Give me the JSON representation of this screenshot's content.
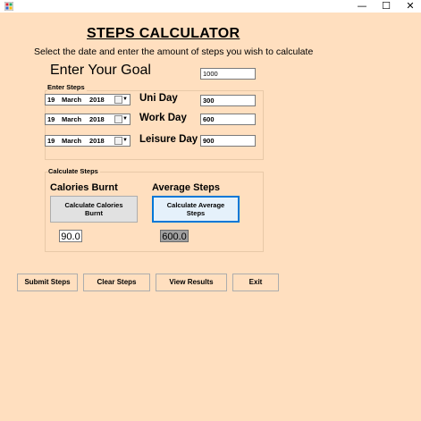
{
  "window": {
    "minimize_glyph": "—",
    "maximize_glyph": "☐",
    "close_glyph": "✕"
  },
  "header": {
    "title": "STEPS CALCULATOR",
    "subtitle": "Select the date and enter the amount of steps you wish to calculate"
  },
  "goal": {
    "label": "Enter Your Goal",
    "value": "1000"
  },
  "enter_steps": {
    "group_title": "Enter Steps",
    "rows": [
      {
        "day": "19",
        "month": "March",
        "year": "2018",
        "label": "Uni Day",
        "value": "300"
      },
      {
        "day": "19",
        "month": "March",
        "year": "2018",
        "label": "Work Day",
        "value": "600"
      },
      {
        "day": "19",
        "month": "March",
        "year": "2018",
        "label": "Leisure Day",
        "value": "900"
      }
    ]
  },
  "calculate_steps": {
    "group_title": "Calculate Steps",
    "calories_heading": "Calories Burnt",
    "average_heading": "Average Steps",
    "calories_button": "Calculate Calories Burnt",
    "average_button": "Calculate Average Steps",
    "calories_result": "90.0",
    "average_result": "600.0"
  },
  "actions": {
    "submit": "Submit Steps",
    "clear": "Clear Steps",
    "view": "View Results",
    "exit": "Exit"
  },
  "colors": {
    "form_background": "#ffdfbf",
    "focus_border": "#0078d7",
    "average_result_background": "#a0a0a0"
  }
}
